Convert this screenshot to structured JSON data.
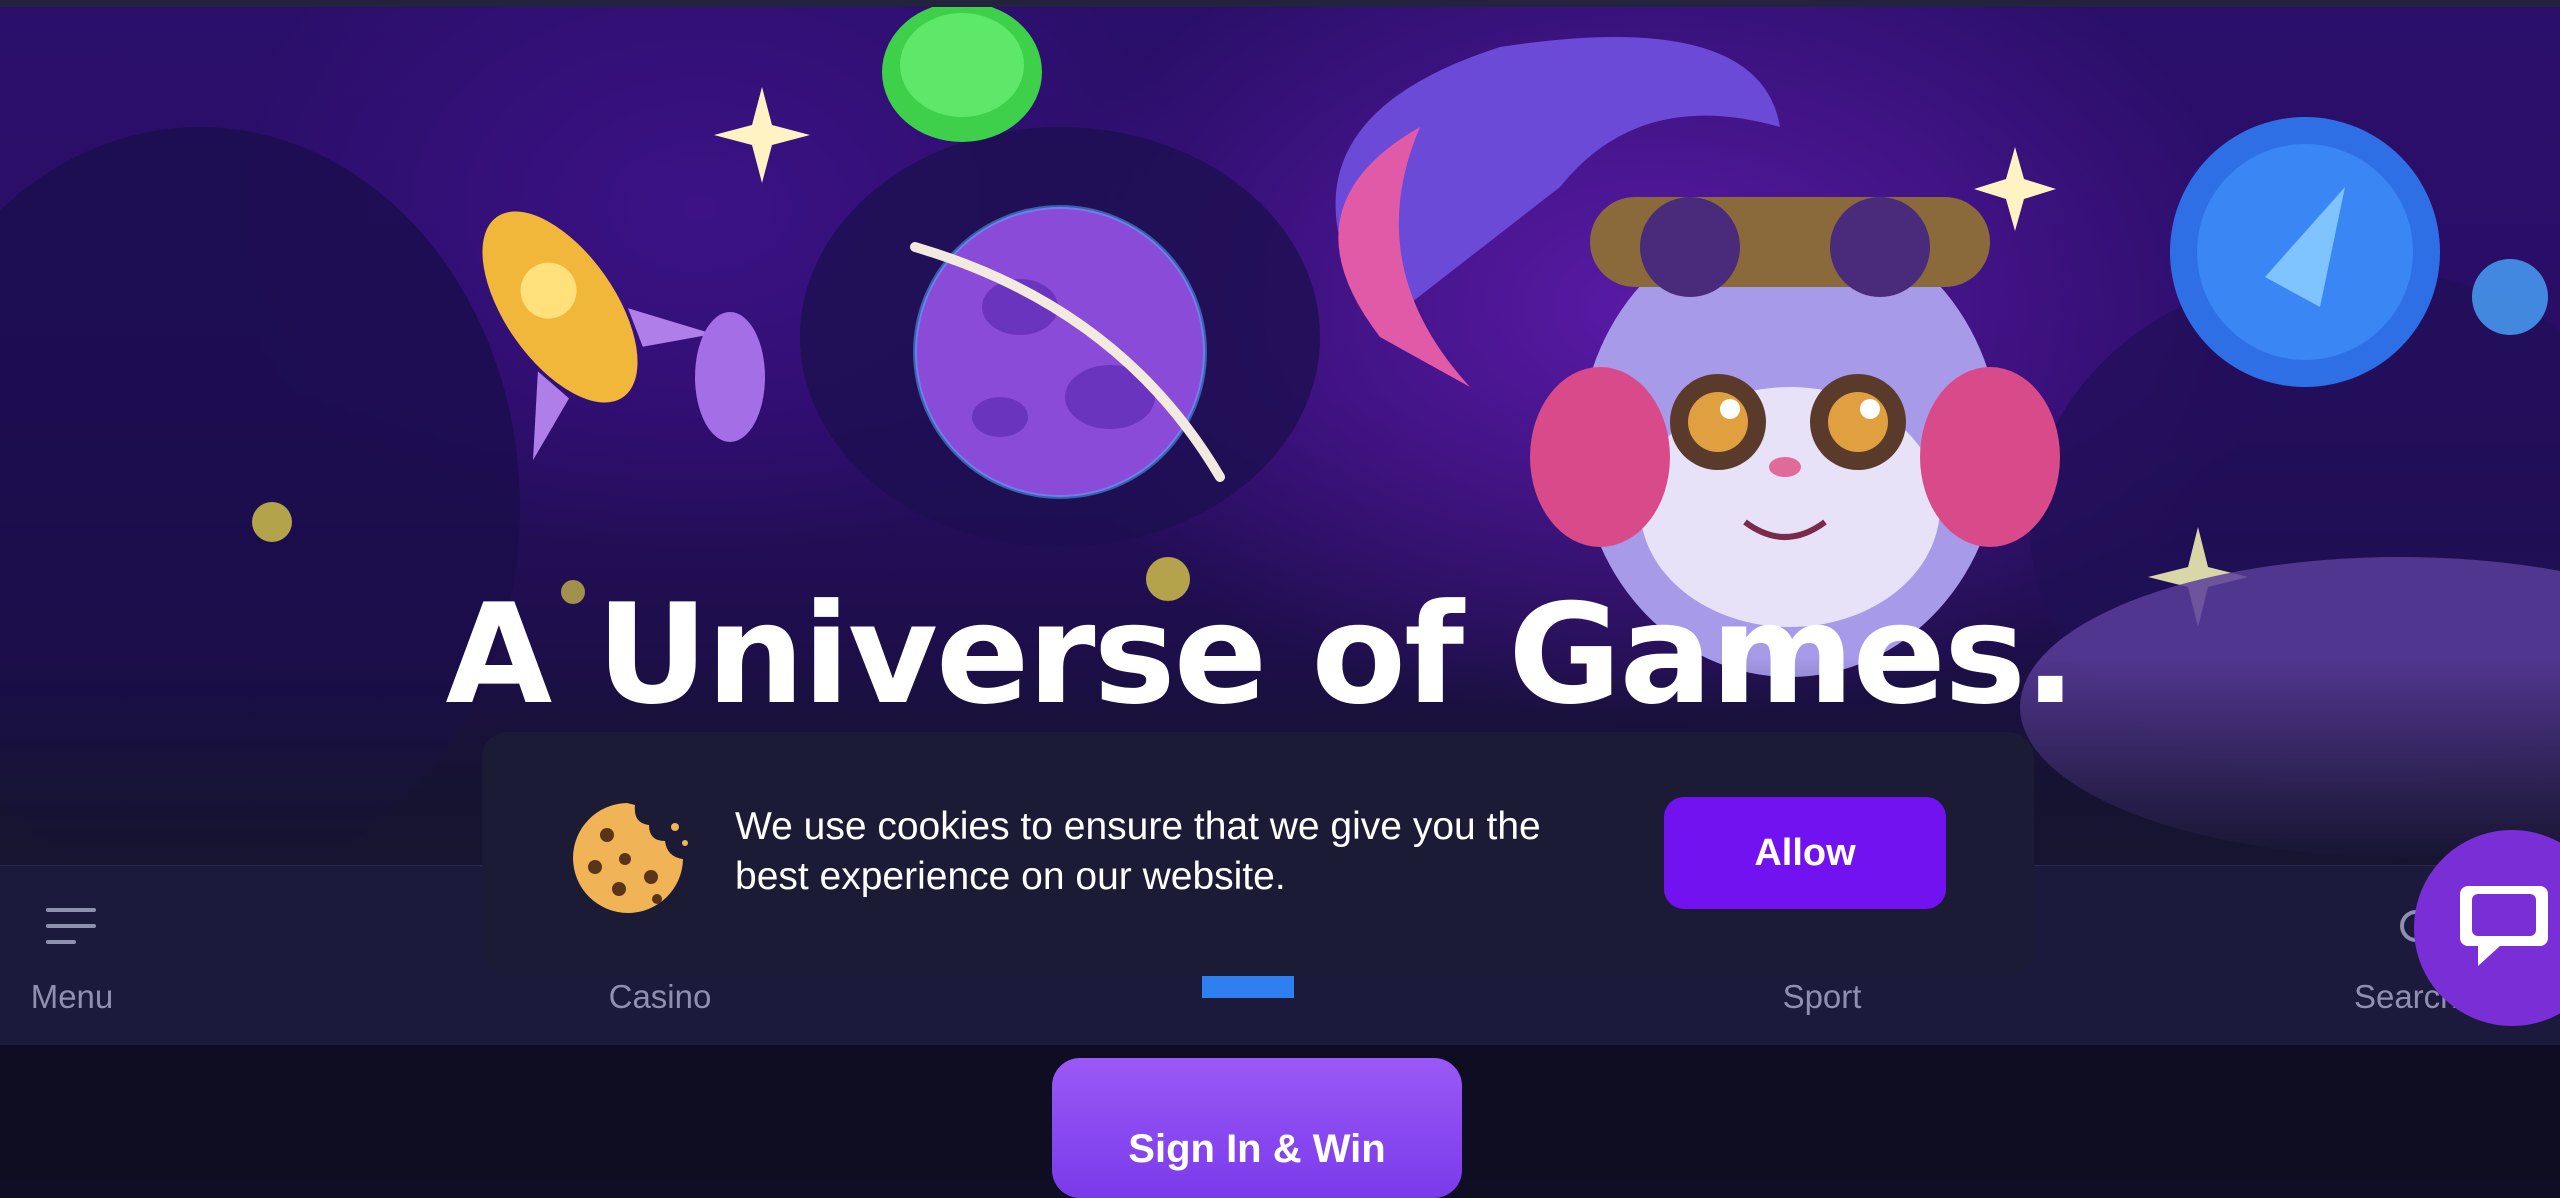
{
  "hero": {
    "title": "A Universe of Games."
  },
  "cookie_banner": {
    "text": "We use cookies to ensure that we give you the best experience on our website.",
    "allow_label": "Allow",
    "icon": "cookie-icon"
  },
  "nav": {
    "items": [
      {
        "label": "Menu",
        "icon": "hamburger-icon"
      },
      {
        "label": "Casino",
        "icon": "cards-icon"
      },
      {
        "label": "",
        "icon": "center-badge-icon"
      },
      {
        "label": "Sport",
        "icon": "ball-icon"
      },
      {
        "label": "Search...",
        "icon": "search-icon"
      }
    ]
  },
  "signin_label": "Sign In & Win",
  "chat_icon": "chat-bubble-icon",
  "colors": {
    "accent": "#7212f0",
    "signin": "#8a4af2",
    "navbar": "#1b1a3c",
    "cookie_panel": "#1c1b36"
  }
}
